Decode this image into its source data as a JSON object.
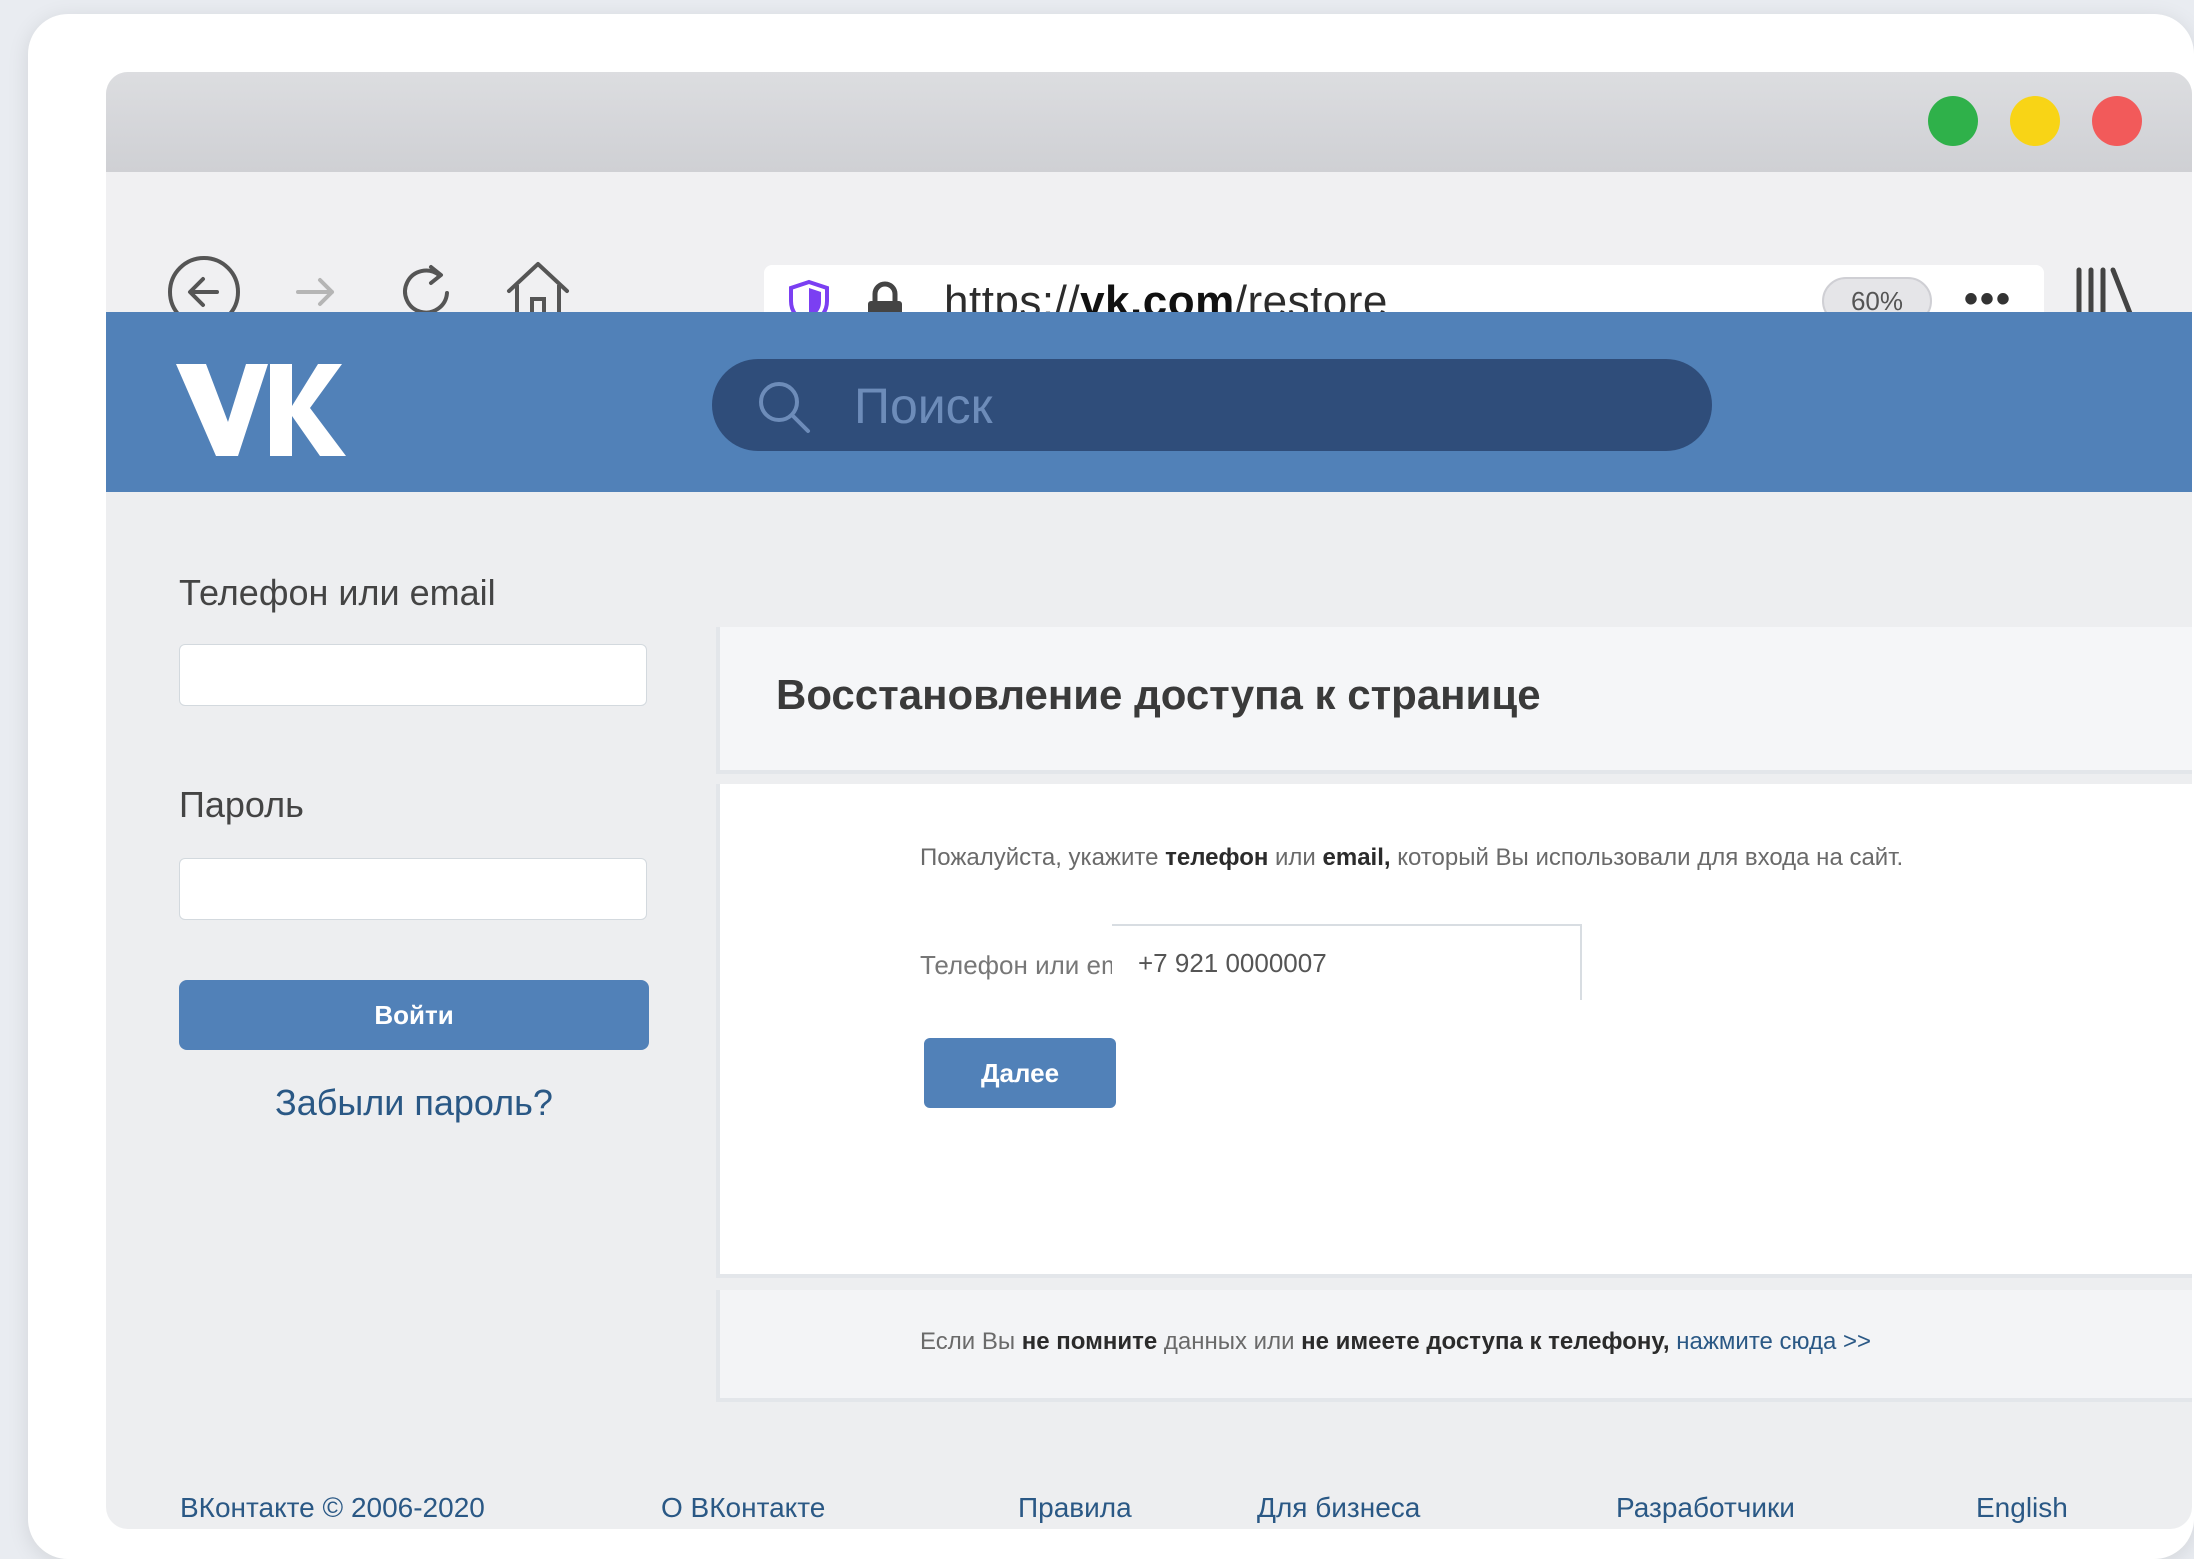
{
  "browser": {
    "url_prefix": "https://",
    "url_domain": "vk.com",
    "url_path": "/restore",
    "zoom": "60%",
    "more": "•••"
  },
  "header": {
    "search_placeholder": "Поиск"
  },
  "login": {
    "phone_label": "Телефон или email",
    "password_label": "Пароль",
    "login_button": "Войти",
    "forgot_link": "Забыли пароль?"
  },
  "restore": {
    "title": "Восстановление доступа к странице",
    "instruction_prefix": "Пожалуйста, укажите ",
    "instruction_bold1": "телефон",
    "instruction_mid": " или ",
    "instruction_bold2": "email,",
    "instruction_suffix": " который Вы использовали для входа на сайт.",
    "field_label": "Телефон или email",
    "field_value": "+7 921 0000007",
    "next_button": "Далее",
    "footer_prefix": "Если Вы ",
    "footer_bold1": "не помните",
    "footer_mid1": " данных или ",
    "footer_bold2": "не имеете доступа к телефону,",
    "footer_link": "нажмите сюда >>"
  },
  "footer": {
    "copyright": "ВКонтакте © 2006-2020",
    "links": [
      "О ВКонтакте",
      "Правила",
      "Для бизнеса",
      "Разработчики",
      "English"
    ]
  },
  "colors": {
    "vk_blue": "#5181b8",
    "search_bg": "#2f4d7a",
    "link": "#2a5885",
    "dot_green": "#2fb14a",
    "dot_yellow": "#f8d416",
    "dot_red": "#f25a5a"
  }
}
